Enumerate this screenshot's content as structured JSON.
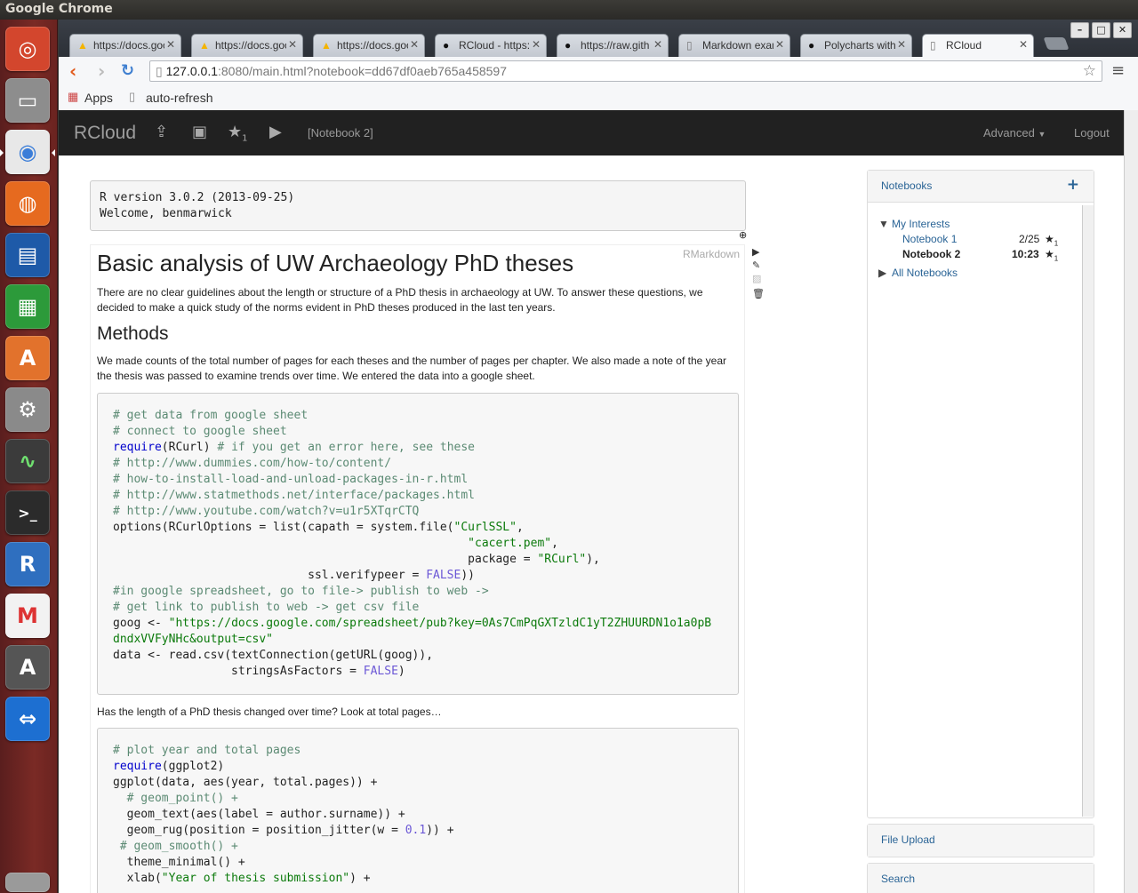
{
  "os": {
    "title": "Google Chrome"
  },
  "browser": {
    "tabs": [
      {
        "title": "https://docs.goo",
        "favicon": "google-drive"
      },
      {
        "title": "https://docs.goo",
        "favicon": "google-drive"
      },
      {
        "title": "https://docs.goo",
        "favicon": "google-drive"
      },
      {
        "title": "RCloud - https:/",
        "favicon": "github"
      },
      {
        "title": "https://raw.gith",
        "favicon": "github"
      },
      {
        "title": "Markdown exam",
        "favicon": "page"
      },
      {
        "title": "Polycharts with",
        "favicon": "github"
      },
      {
        "title": "RCloud",
        "favicon": "page"
      }
    ],
    "url_host": "127.0.0.1",
    "url_rest": ":8080/main.html?notebook=dd67df0aeb765a458597",
    "bookmarks": {
      "apps": "Apps",
      "auto_refresh": "auto-refresh"
    }
  },
  "rcloud": {
    "brand": "RCloud",
    "star_count": "1",
    "notebook_title": "[Notebook 2]",
    "advanced": "Advanced",
    "logout": "Logout",
    "r_version": "R version 3.0.2 (2013-09-25)",
    "welcome": "Welcome, benmarwick",
    "cell_lang": "RMarkdown",
    "h1": "Basic analysis of UW Archaeology PhD theses",
    "intro": "There are no clear guidelines about the length or structure of a PhD thesis in archaeology at UW. To answer these questions, we decided to make a quick study of the norms evident in PhD theses produced in the last ten years.",
    "h2": "Methods",
    "methods": "We made counts of the total number of pages for each theses and the number of pages per chapter. We also made a note of the year the thesis was passed to examine trends over time. We entered the data into a google sheet.",
    "question": "Has the length of a PhD thesis changed over time? Look at total pages…",
    "code1": [
      [
        [
          "c-cm",
          "# get data from google sheet"
        ]
      ],
      [
        [
          "c-cm",
          "# connect to google sheet"
        ]
      ],
      [
        [
          "c-kw",
          "require"
        ],
        [
          "",
          "(RCurl) "
        ],
        [
          "c-cm",
          "# if you get an error here, see these"
        ]
      ],
      [
        [
          "c-cm",
          "# http://www.dummies.com/how-to/content/"
        ]
      ],
      [
        [
          "c-cm",
          "# how-to-install-load-and-unload-packages-in-r.html"
        ]
      ],
      [
        [
          "c-cm",
          "# http://www.statmethods.net/interface/packages.html"
        ]
      ],
      [
        [
          "c-cm",
          "# http://www.youtube.com/watch?v=u1r5XTqrCTQ"
        ]
      ],
      [
        [
          "",
          "options(RCurlOptions = list(capath = system.file("
        ],
        [
          "c-str",
          "\"CurlSSL\""
        ],
        [
          "",
          ","
        ]
      ],
      [
        [
          "",
          "                                                   "
        ],
        [
          "c-str",
          "\"cacert.pem\""
        ],
        [
          "",
          ","
        ]
      ],
      [
        [
          "",
          "                                                   package = "
        ],
        [
          "c-str",
          "\"RCurl\""
        ],
        [
          "",
          "),"
        ]
      ],
      [
        [
          "",
          "                            ssl.verifypeer = "
        ],
        [
          "c-ct",
          "FALSE"
        ],
        [
          "",
          "))"
        ]
      ],
      [
        [
          "c-cm",
          "#in google spreadsheet, go to file-> publish to web ->"
        ]
      ],
      [
        [
          "c-cm",
          "# get link to publish to web -> get csv file"
        ]
      ],
      [
        [
          "",
          "goog <- "
        ],
        [
          "c-str",
          "\"https://docs.google.com/spreadsheet/pub?key=0As7CmPqGXTzldC1yT2ZHUURDN1o1a0pB"
        ]
      ],
      [
        [
          "c-str",
          "dndxVVFyNHc&output=csv\""
        ]
      ],
      [
        [
          "",
          "data <- read.csv(textConnection(getURL(goog)),"
        ]
      ],
      [
        [
          "",
          "                 stringsAsFactors = "
        ],
        [
          "c-ct",
          "FALSE"
        ],
        [
          "",
          ")"
        ]
      ]
    ],
    "code2": [
      [
        [
          "c-cm",
          "# plot year and total pages"
        ]
      ],
      [
        [
          "c-kw",
          "require"
        ],
        [
          "",
          "(ggplot2)"
        ]
      ],
      [
        [
          "",
          "ggplot(data, aes(year, total.pages)) +"
        ]
      ],
      [
        [
          "c-cm",
          "  # geom_point() +"
        ]
      ],
      [
        [
          "",
          "  geom_text(aes(label = author.surname)) +"
        ]
      ],
      [
        [
          "",
          "  geom_rug(position = position_jitter(w = "
        ],
        [
          "c-ct",
          "0.1"
        ],
        [
          "",
          ")) +"
        ]
      ],
      [
        [
          "c-cm",
          " # geom_smooth() +"
        ]
      ],
      [
        [
          "",
          "  theme_minimal() +"
        ]
      ],
      [
        [
          "",
          "  xlab("
        ],
        [
          "c-str",
          "\"Year of thesis submission\""
        ],
        [
          "",
          ") +"
        ]
      ]
    ],
    "sidebar": {
      "notebooks_title": "Notebooks",
      "my_interests": "My Interests",
      "notebooks": [
        {
          "name": "Notebook 1",
          "meta": "2/25",
          "stars": "1"
        },
        {
          "name": "Notebook 2",
          "meta": "10:23",
          "stars": "1"
        }
      ],
      "all_notebooks": "All Notebooks",
      "file_upload": "File Upload",
      "search": "Search"
    }
  }
}
